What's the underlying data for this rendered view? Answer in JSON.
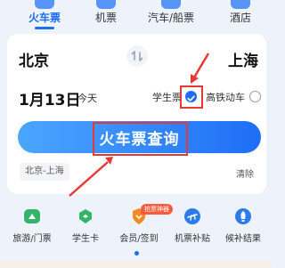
{
  "tabs": [
    {
      "label": "火车票",
      "active": true
    },
    {
      "label": "机票",
      "active": false
    },
    {
      "label": "汽车/船票",
      "active": false
    },
    {
      "label": "酒店",
      "active": false
    }
  ],
  "trip": {
    "from": "北京",
    "to": "上海",
    "date": "1月13日",
    "day": "今天"
  },
  "options": {
    "student_label": "学生票",
    "student_checked": true,
    "highspeed_label": "高铁动车",
    "highspeed_checked": false
  },
  "search_label": "火车票查询",
  "history": {
    "item": "北京-上海",
    "clear_label": "清除"
  },
  "grid": [
    {
      "label": "旅游/门票",
      "icon": "ticket-icon"
    },
    {
      "label": "学生卡",
      "icon": "student-card-icon"
    },
    {
      "label": "会员/签到",
      "icon": "member-shield-icon"
    },
    {
      "label": "机票补贴",
      "icon": "plane-subsidy-icon"
    },
    {
      "label": "候补结果",
      "icon": "rocket-icon"
    }
  ],
  "grid_badge": "抢票神器",
  "colors": {
    "accent": "#1f6df5",
    "annotation": "#e53935"
  }
}
